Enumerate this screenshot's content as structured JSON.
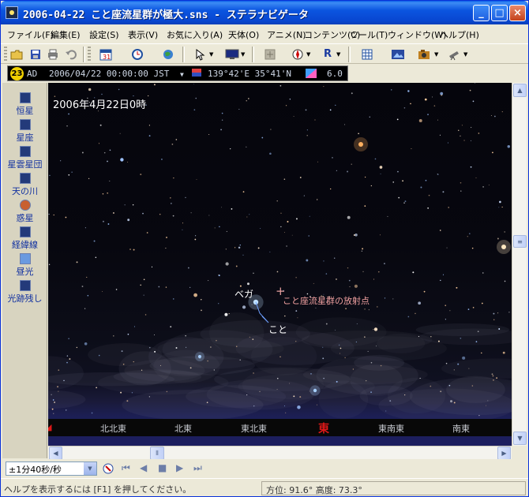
{
  "window": {
    "title": "2006-04-22 こと座流星群が極大.sns - ステラナビゲータ",
    "minimize_glyph": "_",
    "maximize_glyph": "□",
    "close_glyph": "×"
  },
  "menu": [
    "ファイル(F)",
    "編集(E)",
    "設定(S)",
    "表示(V)",
    "お気に入り(A)",
    "天体(O)",
    "アニメ(N)",
    "コンテンツ(C)",
    "ツール(T)",
    "ウィンドウ(W)",
    "ヘルプ(H)"
  ],
  "toolbar_icons": [
    "open-folder-icon",
    "save-icon",
    "print-icon",
    "undo-icon",
    "calendar-icon",
    "clock-icon",
    "globe-icon",
    "pointer-icon",
    "monitor-icon",
    "zoom-icon",
    "compass-icon",
    "r-icon",
    "grid-icon",
    "photo-icon",
    "camera-icon",
    "telescope-icon"
  ],
  "infobar": {
    "badge": "23",
    "era": "AD",
    "datetime": "2006/04/22 00:00:00 JST",
    "location": "139°42'E 35°41'N",
    "magnitude": "6.0"
  },
  "left_panel": [
    "恒星",
    "星座",
    "星雲星団",
    "天の川",
    "惑星",
    "経緯線",
    "昼光",
    "光跡残し"
  ],
  "sky": {
    "date_label": "2006年4月22日0時",
    "star_labels": [
      "ベガ",
      "こと"
    ],
    "radiant_label": "こと座流星群の放射点",
    "horizon_labels": [
      "北北東",
      "北東",
      "東北東",
      "東",
      "東南東",
      "南東"
    ]
  },
  "controls": {
    "speed": "±1分40秒/秒"
  },
  "status": {
    "help": "ヘルプを表示するには [F1] を押してください。",
    "coords": "方位: 91.6°  高度: 73.3°"
  },
  "colors": {
    "title_bar": "#0a55e0",
    "sky_dark": "#05050c",
    "horizon_blue": "#1c1e60",
    "east_marker": "#e01818",
    "radiant_label": "#f0a0a0"
  }
}
